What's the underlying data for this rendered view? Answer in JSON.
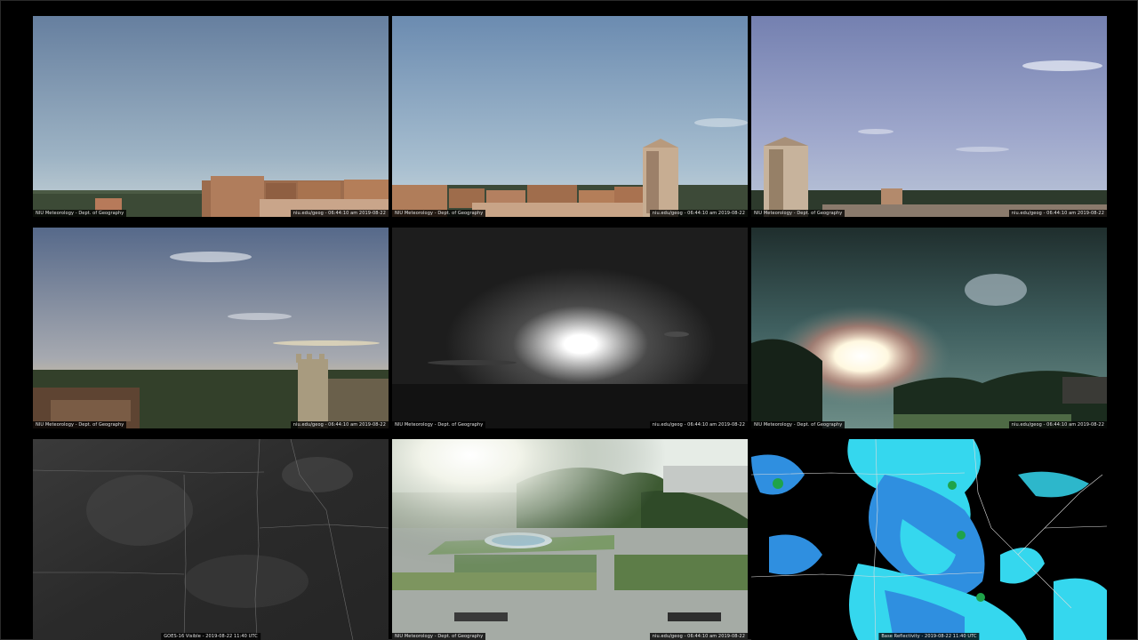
{
  "captions": {
    "t1_left": "NIU Meteorology - Dept. of Geography",
    "t1_right": "niu.edu/geog - 06:44:10 am 2019-08-22",
    "t2_left": "NIU Meteorology - Dept. of Geography",
    "t2_right": "niu.edu/geog - 06:44:10 am 2019-08-22",
    "t3_left": "NIU Meteorology - Dept. of Geography",
    "t3_right": "niu.edu/geog - 06:44:10 am 2019-08-22",
    "t4_left": "NIU Meteorology - Dept. of Geography",
    "t4_right": "niu.edu/geog - 06:44:10 am 2019-08-22",
    "t5_left": "NIU Meteorology - Dept. of Geography",
    "t5_right": "niu.edu/geog - 06:44:10 am 2019-08-22",
    "t6_left": "NIU Meteorology - Dept. of Geography",
    "t6_right": "niu.edu/geog - 06:44:10 am 2019-08-22",
    "t7_bottom": "GOES-16 Visible - 2019-08-22 11:40 UTC",
    "t8_left": "NIU Meteorology - Dept. of Geography",
    "t8_right": "niu.edu/geog - 06:44:10 am 2019-08-22",
    "t9_bottom": "Base Reflectivity - 2019-08-22 11:40 UTC"
  },
  "colors": {
    "sky_top": "#6f8db1",
    "sky_bottom": "#b9c9d6",
    "brick": "#a9724f",
    "radar_light": "#35d7ee",
    "radar_mid": "#2f8fe0",
    "radar_green": "#1fa34a"
  }
}
